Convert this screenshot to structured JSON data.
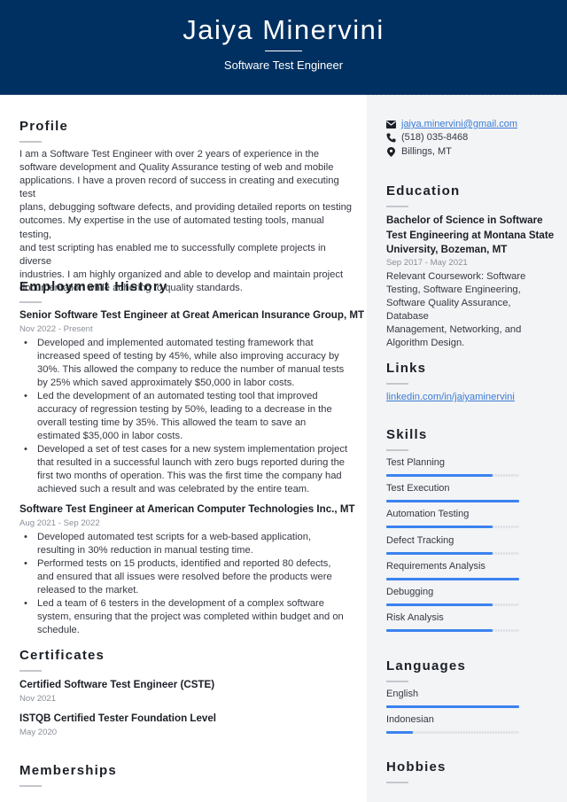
{
  "header": {
    "name": "Jaiya Minervini",
    "title": "Software Test Engineer",
    "background_color": "#003061"
  },
  "profile": {
    "heading": "Profile",
    "lines": [
      "I am a Software Test Engineer with over 2 years of experience in the",
      "software development and Quality Assurance testing of web and mobile",
      "applications. I have a proven record of success in creating and executing test",
      "plans, debugging software defects, and providing detailed reports on testing",
      "outcomes. My expertise in the use of automated testing tools, manual testing,",
      "and test scripting has enabled me to successfully complete projects in diverse",
      "industries. I am highly organized and able to develop and maintain project",
      "documentation while adhering to quality standards."
    ]
  },
  "employment": {
    "heading": "Employment History",
    "jobs": [
      {
        "title": "Senior Software Test Engineer at Great American Insurance Group, MT",
        "dates": "Nov 2022 - Present",
        "bullets": [
          "Developed and implemented automated testing framework that increased speed of testing by 45%, while also improving accuracy by 30%. This allowed the company to reduce the number of manual tests by 25% which saved approximately $50,000 in labor costs.",
          "Led the development of an automated testing tool that improved accuracy of regression testing by 50%, leading to a decrease in the overall testing time by 35%. This allowed the team to save an estimated $35,000 in labor costs.",
          "Developed a set of test cases for a new system implementation project that resulted in a successful launch with zero bugs reported during the first two months of operation. This was the first time the company had achieved such a result and was celebrated by the entire team."
        ]
      },
      {
        "title": "Software Test Engineer at American Computer Technologies Inc., MT",
        "dates": "Aug 2021 - Sep 2022",
        "bullets": [
          "Developed automated test scripts for a web-based application, resulting in 30% reduction in manual testing time.",
          "Performed tests on 15 products, identified and reported 80 defects, and ensured that all issues were resolved before the products were released to the market.",
          "Led a team of 6 testers in the development of a complex software system, ensuring that the project was completed within budget and on schedule."
        ]
      }
    ]
  },
  "certificates": {
    "heading": "Certificates",
    "items": [
      {
        "name": "Certified Software Test Engineer (CSTE)",
        "date": "Nov 2021"
      },
      {
        "name": "ISTQB Certified Tester Foundation Level",
        "date": "May 2020"
      }
    ]
  },
  "memberships": {
    "heading": "Memberships"
  },
  "contact": {
    "email": "jaiya.minervini@gmail.com",
    "phone": "(518) 035-8468",
    "location": "Billings, MT",
    "icons": [
      "envelope-icon",
      "phone-icon",
      "map-pin-icon"
    ]
  },
  "education": {
    "heading": "Education",
    "degree_lines": [
      "Bachelor of Science in Software",
      "Test Engineering at Montana State",
      "University, Bozeman, MT"
    ],
    "dates": "Sep 2017 - May 2021",
    "coursework_lines": [
      "Relevant Coursework: Software",
      "Testing, Software Engineering,",
      "Software Quality Assurance, Database",
      "Management, Networking, and",
      "Algorithm Design."
    ]
  },
  "links": {
    "heading": "Links",
    "items": [
      "linkedin.com/in/jaiyaminervini"
    ]
  },
  "skills": {
    "heading": "Skills",
    "accent_color": "#3b82f0",
    "items": [
      {
        "name": "Test Planning",
        "level": 0.8
      },
      {
        "name": "Test Execution",
        "level": 1.0
      },
      {
        "name": "Automation Testing",
        "level": 0.8
      },
      {
        "name": "Defect Tracking",
        "level": 0.8
      },
      {
        "name": "Requirements Analysis",
        "level": 1.0
      },
      {
        "name": "Debugging",
        "level": 0.8
      },
      {
        "name": "Risk Analysis",
        "level": 0.8
      }
    ]
  },
  "languages": {
    "heading": "Languages",
    "items": [
      {
        "name": "English",
        "level": 1.0
      },
      {
        "name": "Indonesian",
        "level": 0.2
      }
    ]
  },
  "hobbies": {
    "heading": "Hobbies"
  }
}
